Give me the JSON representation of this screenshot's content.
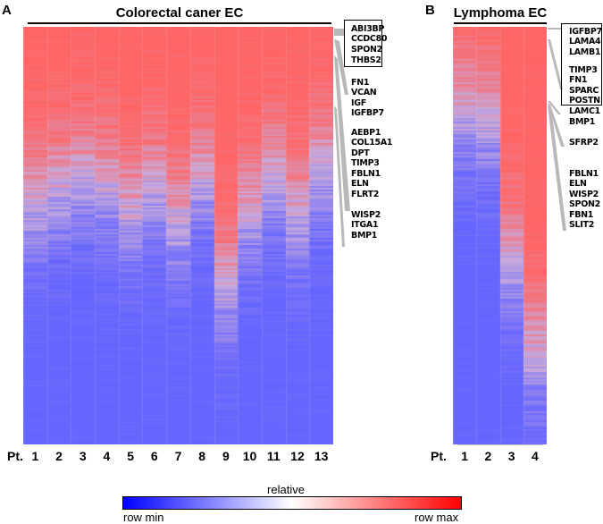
{
  "chart_data": [
    {
      "type": "heatmap",
      "panel": "A",
      "title": "Colorectal caner EC",
      "x_prefix": "Pt.",
      "columns": [
        "1",
        "2",
        "3",
        "4",
        "5",
        "6",
        "7",
        "8",
        "9",
        "10",
        "11",
        "12",
        "13"
      ],
      "color_scale": "relative (row min → row max)",
      "row_order": "sorted by descending mean relative expression",
      "gene_groups": [
        {
          "genes": [
            "ABI3BP",
            "CCDC80",
            "SPON2",
            "THBS2"
          ],
          "boxed": true,
          "row_range_fraction": [
            0.0,
            0.02
          ]
        },
        {
          "genes": [
            "FN1",
            "VCAN",
            "IGF",
            "IGFBP7"
          ],
          "boxed": false,
          "row_range_fraction": [
            0.03,
            0.15
          ]
        },
        {
          "genes": [
            "AEBP1",
            "COL15A1",
            "DPT",
            "TIMP3",
            "FBLN1",
            "ELN",
            "FLRT2"
          ],
          "boxed": false,
          "row_range_fraction": [
            0.06,
            0.36
          ]
        },
        {
          "genes": [
            "WISP2",
            "ITGA1",
            "BMP1"
          ],
          "boxed": false,
          "row_range_fraction": [
            0.24,
            0.48
          ]
        }
      ],
      "column_profile_note": "Top ~30% of rows high (red) in all patients; lower rows low (blue); Pt. 8 and 9 retain pinkish values further down",
      "column_high_extent": [
        0.42,
        0.38,
        0.36,
        0.38,
        0.44,
        0.38,
        0.46,
        0.36,
        0.62,
        0.44,
        0.36,
        0.44,
        0.34
      ]
    },
    {
      "type": "heatmap",
      "panel": "B",
      "title": "Lymphoma EC",
      "x_prefix": "Pt.",
      "columns": [
        "1",
        "2",
        "3",
        "4"
      ],
      "color_scale": "relative (row min → row max)",
      "row_order": "sorted by descending mean relative expression",
      "gene_groups": [
        {
          "genes": [
            "IGFBP7",
            "LAMA4",
            "LAMB1"
          ],
          "boxed": true,
          "row_range_fraction": [
            0.0,
            0.0
          ]
        },
        {
          "genes": [
            "TIMP3",
            "FN1",
            "SPARC",
            "POSTN"
          ],
          "boxed": true,
          "row_range_fraction": [
            0.0,
            0.05
          ]
        },
        {
          "genes": [
            "LAMC1",
            "BMP1"
          ],
          "boxed": false,
          "row_range_fraction": [
            0.08,
            0.12
          ]
        },
        {
          "genes": [
            "SFRP2"
          ],
          "boxed": false,
          "row_range_fraction": [
            0.1,
            0.18
          ]
        },
        {
          "genes": [
            "FBLN1",
            "ELN",
            "WISP2",
            "SPON2",
            "FBN1",
            "SLIT2"
          ],
          "boxed": false,
          "row_range_fraction": [
            0.12,
            0.36
          ]
        }
      ],
      "column_profile_note": "Pt. 4 largely red through ~70% of rows; Pt. 3 intermediate; Pt. 1 and 2 shift to blue after ~20%",
      "column_high_extent": [
        0.2,
        0.22,
        0.55,
        0.78
      ]
    }
  ],
  "panels": {
    "a": {
      "letter": "A",
      "title": "Colorectal caner EC",
      "pt_label": "Pt."
    },
    "b": {
      "letter": "B",
      "title": "Lymphoma EC",
      "pt_label": "Pt."
    }
  },
  "legend": {
    "title": "relative",
    "min_label": "row min",
    "max_label": "row max",
    "colors": {
      "min": "#0000ff",
      "mid": "#ffffff",
      "max": "#ff0000"
    }
  },
  "colors": {
    "heat_high": "#ff6666",
    "heat_low": "#6666ff",
    "connector": "#b0b0b0"
  }
}
